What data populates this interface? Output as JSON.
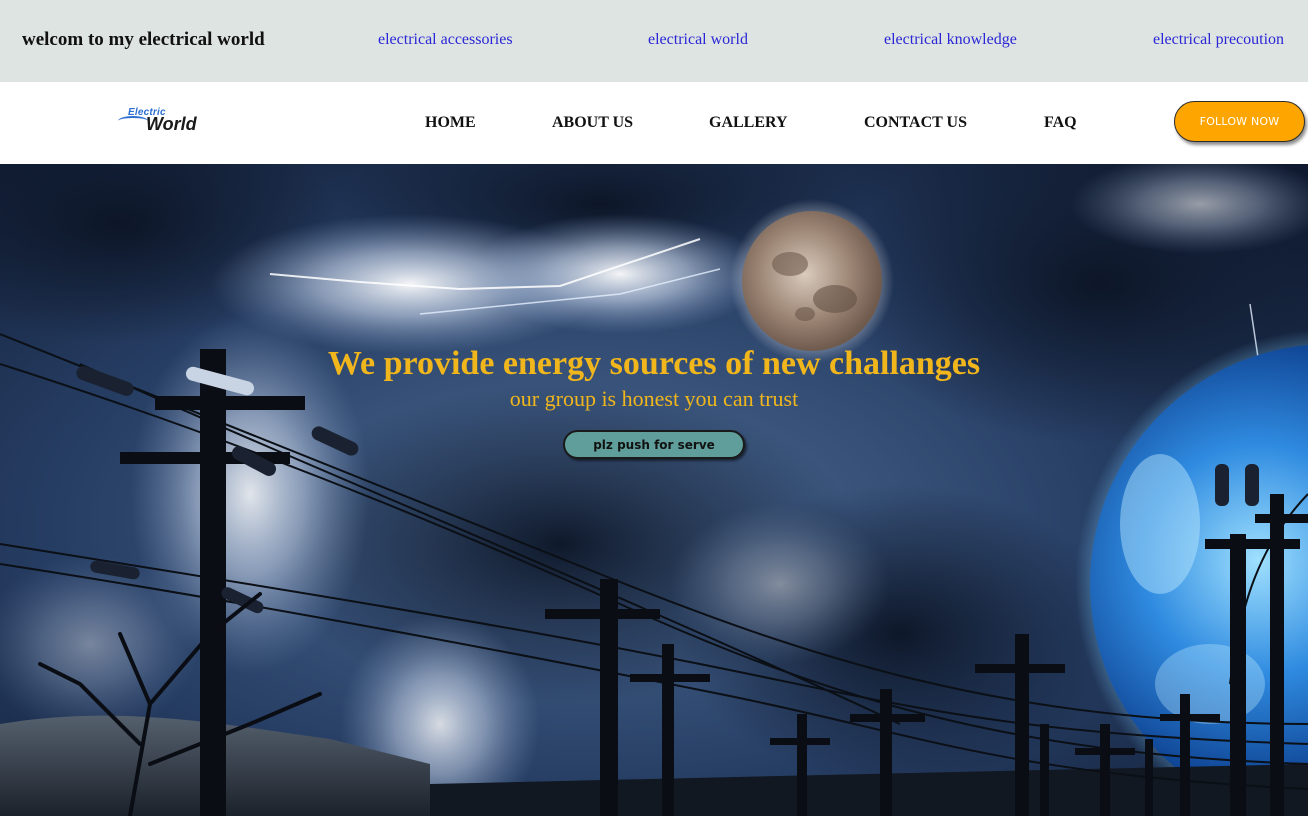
{
  "topbar": {
    "welcome": "welcom to my electrical world",
    "links": [
      "electrical accessories",
      "electrical world",
      "electrical knowledge",
      "electrical precoution"
    ]
  },
  "navbar": {
    "logo": {
      "top": "Electric",
      "bottom": "World"
    },
    "links": [
      "HOME",
      "ABOUT US",
      "GALLERY",
      "CONTACT US",
      "FAQ"
    ],
    "follow_label": "FOLLOW NOW"
  },
  "hero": {
    "title": "We provide energy sources of new challanges",
    "subtitle": "our group is honest you can trust",
    "button_label": "plz push for serve",
    "background_image": "stormy-night-power-lines-moon-planet"
  },
  "colors": {
    "topbar_bg": "#dde4e1",
    "top_link": "#2b26d6",
    "accent_orange": "#ffa500",
    "hero_text": "#f0b61c",
    "button_teal": "#5f9e9b"
  }
}
